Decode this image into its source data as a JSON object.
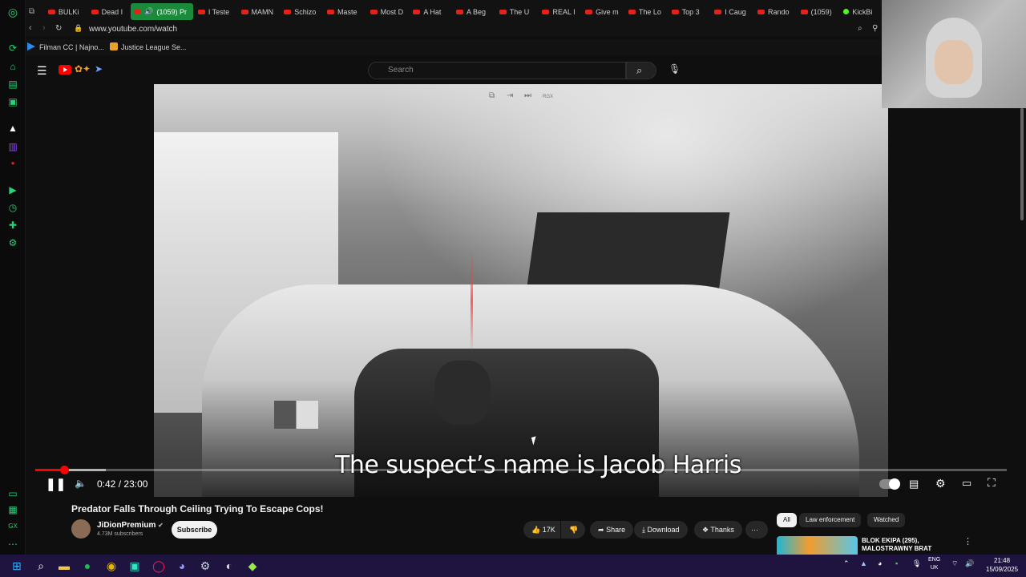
{
  "browser": {
    "tabs": [
      "BULKi",
      "Dead I",
      "(1059) Pr",
      "I Teste",
      "MAMN",
      "Schizo",
      "Maste",
      "Most D",
      "A Hat",
      "A Beg",
      "The U",
      "REAL I",
      "Give m",
      "The Lo",
      "Top 3",
      "I Caug",
      "Rando",
      "(1059)",
      "KickBi"
    ],
    "url": "www.youtube.com/watch",
    "bookmarks": [
      "Filman CC | Najno...",
      "Justice League Se..."
    ]
  },
  "youtube": {
    "search_placeholder": "Search",
    "player": {
      "time_current": "0:42",
      "time_separator": "/",
      "time_total": "23:00",
      "progress_fraction": 0.03,
      "caption": "The suspect’s name is Jacob Harris",
      "overlay_label": "RGX"
    },
    "video": {
      "title": "Predator Falls Through Ceiling Trying To Escape Cops!",
      "channel": "JiDionPremium",
      "subscribers": "4.73M subscribers",
      "subscribe_label": "Subscribe",
      "likes": "17K",
      "share_label": "Share",
      "download_label": "Download",
      "thanks_label": "Thanks",
      "more_label": "···"
    },
    "chips": [
      "All",
      "Law enforcement",
      "Watched"
    ],
    "recommendation": {
      "title": "BLOK EKIPA (295), MALOSTRAWNY BRAT"
    }
  },
  "taskbar": {
    "language": [
      "ENG",
      "UK"
    ],
    "time": "21:48",
    "date": "15/09/2025"
  },
  "colors": {
    "accent_green": "#27d37a",
    "youtube_red": "#ff0000",
    "taskbar": "#1f1440"
  }
}
